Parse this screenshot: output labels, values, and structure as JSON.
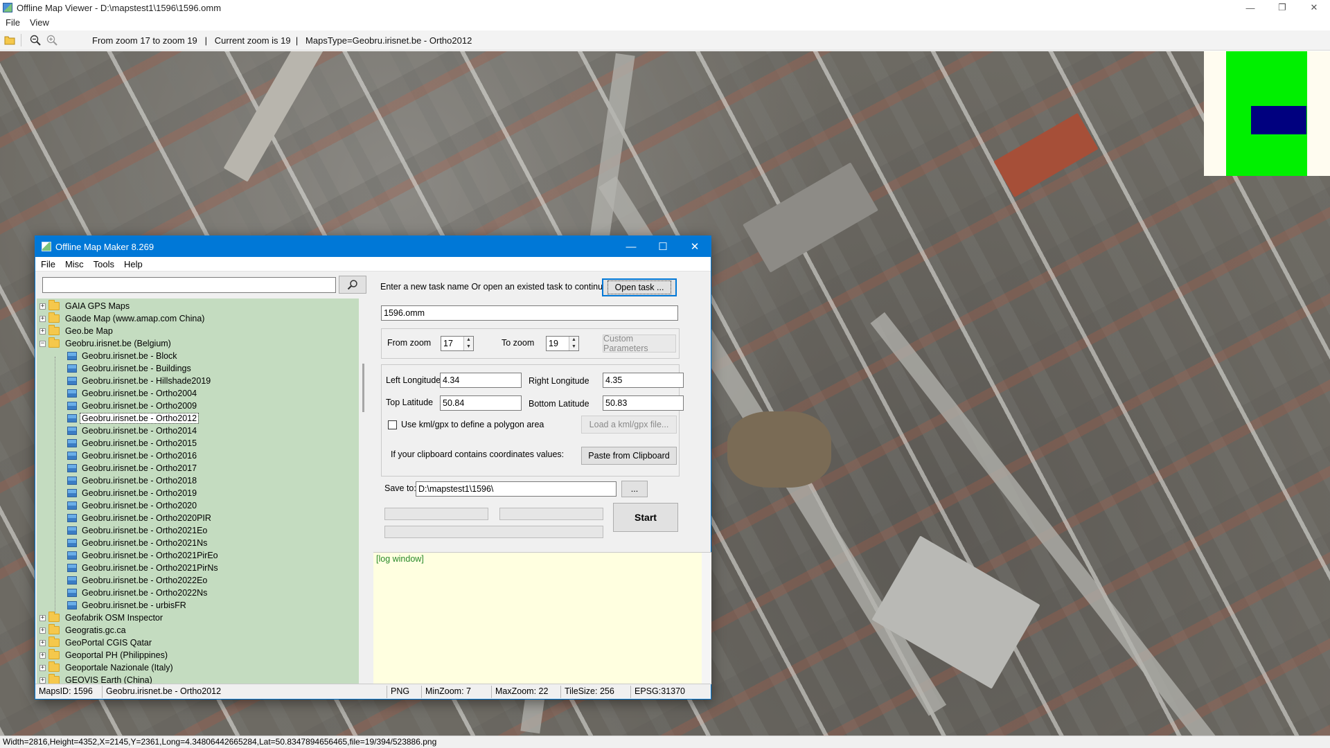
{
  "viewer": {
    "title": "Offline Map Viewer - D:\\mapstest1\\1596\\1596.omm",
    "menu": [
      "File",
      "View"
    ],
    "window_controls": [
      "—",
      "❐",
      "✕"
    ],
    "toolbar_status": "From zoom 17 to zoom 19   |   Current zoom is 19  |   MapsType=Geobru.irisnet.be - Ortho2012",
    "status_bar": "Width=2816,Height=4352,X=2145,Y=2361,Long=4.34806442665284,Lat=50.8347894656465,file=19/394/523886.png"
  },
  "dialog": {
    "title": "Offline Map Maker 8.269",
    "window_controls": [
      "—",
      "☐",
      "✕"
    ],
    "menu": [
      "File",
      "Misc",
      "Tools",
      "Help"
    ],
    "search": {
      "value": "",
      "icon": "search-icon"
    },
    "tree": {
      "before": [
        {
          "label": "GAIA GPS Maps",
          "exp": "+"
        },
        {
          "label": "Gaode Map (www.amap.com China)",
          "exp": "+"
        },
        {
          "label": "Geo.be Map",
          "exp": "+"
        }
      ],
      "parent": {
        "label": "Geobru.irisnet.be (Belgium)",
        "exp": "−"
      },
      "children": [
        "Geobru.irisnet.be - Block",
        "Geobru.irisnet.be - Buildings",
        "Geobru.irisnet.be - Hillshade2019",
        "Geobru.irisnet.be - Ortho2004",
        "Geobru.irisnet.be - Ortho2009",
        "Geobru.irisnet.be - Ortho2012",
        "Geobru.irisnet.be - Ortho2014",
        "Geobru.irisnet.be - Ortho2015",
        "Geobru.irisnet.be - Ortho2016",
        "Geobru.irisnet.be - Ortho2017",
        "Geobru.irisnet.be - Ortho2018",
        "Geobru.irisnet.be - Ortho2019",
        "Geobru.irisnet.be - Ortho2020",
        "Geobru.irisnet.be - Ortho2020PIR",
        "Geobru.irisnet.be - Ortho2021Eo",
        "Geobru.irisnet.be - Ortho2021Ns",
        "Geobru.irisnet.be - Ortho2021PirEo",
        "Geobru.irisnet.be - Ortho2021PirNs",
        "Geobru.irisnet.be - Ortho2022Eo",
        "Geobru.irisnet.be - Ortho2022Ns",
        "Geobru.irisnet.be - urbisFR"
      ],
      "selected_child": "Geobru.irisnet.be - Ortho2012",
      "after": [
        {
          "label": "Geofabrik OSM Inspector",
          "exp": "+"
        },
        {
          "label": "Geogratis.gc.ca",
          "exp": "+"
        },
        {
          "label": "GeoPortal CGIS Qatar",
          "exp": "+"
        },
        {
          "label": "Geoportal PH (Philippines)",
          "exp": "+"
        },
        {
          "label": "Geoportale Nazionale (Italy)",
          "exp": "+"
        },
        {
          "label": "GEOVIS Earth (China)",
          "exp": "+"
        }
      ]
    },
    "task": {
      "prompt": "Enter a new task name Or open an existed task to continue:",
      "open_button": "Open task ...",
      "name_value": "1596.omm"
    },
    "zoom": {
      "from_label": "From zoom",
      "from_value": "17",
      "to_label": "To zoom",
      "to_value": "19",
      "custom_button": "Custom Parameters"
    },
    "area": {
      "left_lon_label": "Left Longitude",
      "left_lon_value": "4.34",
      "right_lon_label": "Right Longitude",
      "right_lon_value": "4.35",
      "top_lat_label": "Top Latitude",
      "top_lat_value": "50.84",
      "bottom_lat_label": "Bottom Latitude",
      "bottom_lat_value": "50.83",
      "kml_label": "Use kml/gpx to define a polygon area",
      "kml_checked": false,
      "kml_button": "Load a kml/gpx file...",
      "clipboard_label": "If your clipboard contains coordinates values:",
      "clipboard_button": "Paste from Clipboard"
    },
    "save": {
      "label": "Save to:",
      "value": "D:\\mapstest1\\1596\\",
      "browse_button": "...",
      "start_button": "Start"
    },
    "log": {
      "text": "[log window]"
    },
    "status": {
      "maps_id": "MapsID: 1596",
      "maps_name": "Geobru.irisnet.be - Ortho2012",
      "format": "PNG",
      "min_zoom": "MinZoom: 7",
      "max_zoom": "MaxZoom: 22",
      "tile_size": "TileSize: 256",
      "epsg": "EPSG:31370"
    }
  },
  "colors": {
    "dialog_accent": "#0078d7",
    "tree_background": "#c4dcc0",
    "log_background": "#ffffe0",
    "overview_green": "#00f000",
    "overview_blue": "#00007f"
  }
}
